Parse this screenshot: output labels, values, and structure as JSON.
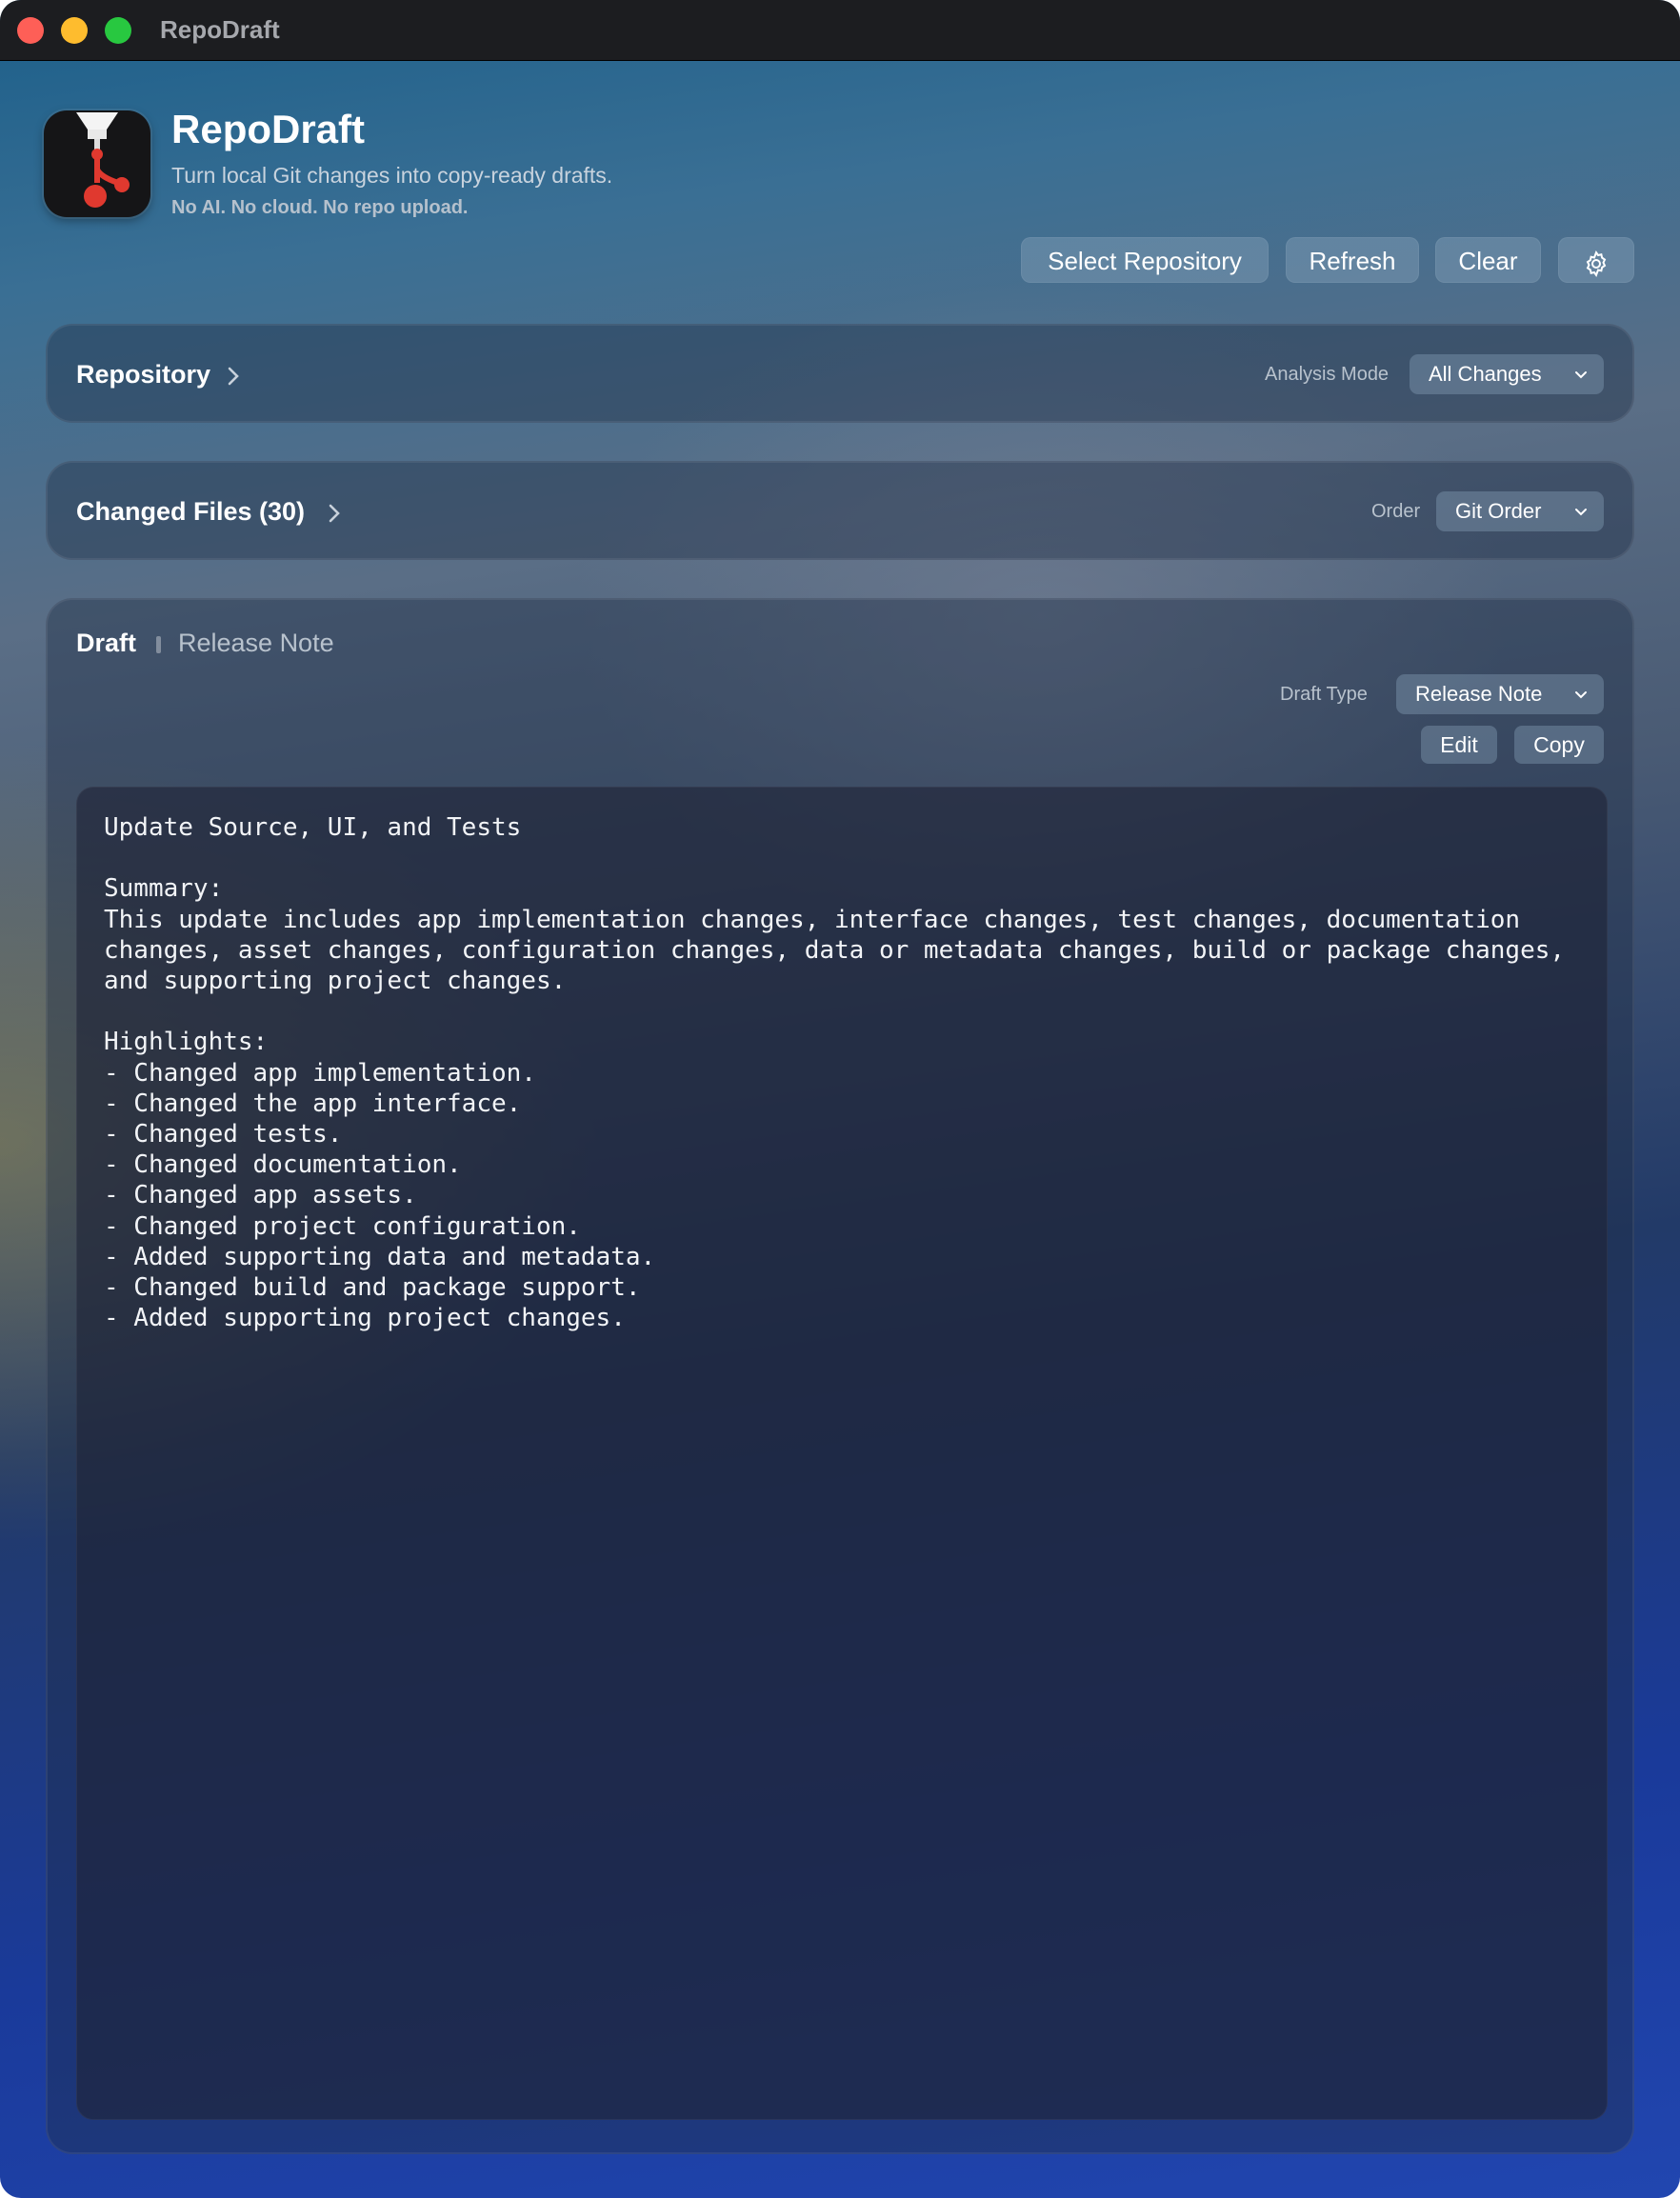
{
  "window": {
    "title": "RepoDraft"
  },
  "header": {
    "app_name": "RepoDraft",
    "tagline": "Turn local Git changes into copy-ready drafts.",
    "subtagline": "No AI. No cloud. No repo upload."
  },
  "toolbar": {
    "select_repository": "Select Repository",
    "refresh": "Refresh",
    "clear": "Clear",
    "settings_icon": "gear-icon"
  },
  "repository_panel": {
    "title": "Repository",
    "analysis_mode_label": "Analysis Mode",
    "analysis_mode_value": "All Changes"
  },
  "changed_files_panel": {
    "title": "Changed Files (30)",
    "order_label": "Order",
    "order_value": "Git Order"
  },
  "draft_panel": {
    "title": "Draft",
    "subtitle": "Release Note",
    "draft_type_label": "Draft Type",
    "draft_type_value": "Release Note",
    "edit": "Edit",
    "copy": "Copy",
    "content": "Update Source, UI, and Tests\n\nSummary:\nThis update includes app implementation changes, interface changes, test changes, documentation changes, asset changes, configuration changes, data or metadata changes, build or package changes, and supporting project changes.\n\nHighlights:\n- Changed app implementation.\n- Changed the app interface.\n- Changed tests.\n- Changed documentation.\n- Changed app assets.\n- Changed project configuration.\n- Added supporting data and metadata.\n- Changed build and package support.\n- Added supporting project changes."
  },
  "colors": {
    "close": "#fe5f57",
    "minimize": "#febc2e",
    "maximize": "#28c840",
    "icon_accent": "#e0392f"
  }
}
